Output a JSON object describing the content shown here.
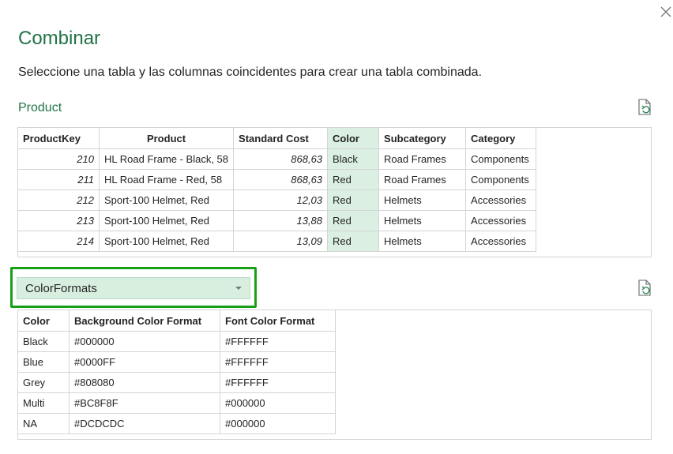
{
  "dialog": {
    "title": "Combinar",
    "description": "Seleccione una tabla y las columnas coincidentes para crear una tabla combinada."
  },
  "first_table": {
    "name": "Product",
    "headers": [
      "ProductKey",
      "Product",
      "Standard Cost",
      "Color",
      "Subcategory",
      "Category"
    ],
    "selected_column": "Color",
    "rows": [
      [
        "210",
        "HL Road Frame - Black, 58",
        "868,63",
        "Black",
        "Road Frames",
        "Components"
      ],
      [
        "211",
        "HL Road Frame - Red, 58",
        "868,63",
        "Red",
        "Road Frames",
        "Components"
      ],
      [
        "212",
        "Sport-100 Helmet, Red",
        "12,03",
        "Red",
        "Helmets",
        "Accessories"
      ],
      [
        "213",
        "Sport-100 Helmet, Red",
        "13,88",
        "Red",
        "Helmets",
        "Accessories"
      ],
      [
        "214",
        "Sport-100 Helmet, Red",
        "13,09",
        "Red",
        "Helmets",
        "Accessories"
      ]
    ]
  },
  "second_table": {
    "selected": "ColorFormats",
    "headers": [
      "Color",
      "Background Color Format",
      "Font Color Format"
    ],
    "rows": [
      [
        "Black",
        "#000000",
        "#FFFFFF"
      ],
      [
        "Blue",
        "#0000FF",
        "#FFFFFF"
      ],
      [
        "Grey",
        "#808080",
        "#FFFFFF"
      ],
      [
        "Multi",
        "#BC8F8F",
        "#000000"
      ],
      [
        "NA",
        "#DCDCDC",
        "#000000"
      ]
    ]
  },
  "icons": {
    "close": "close-icon",
    "refresh": "refresh-preview-icon"
  },
  "colors": {
    "accent_green": "#217346",
    "selected_column_bg": "#dbf0e3",
    "highlight_border": "#16a016"
  }
}
